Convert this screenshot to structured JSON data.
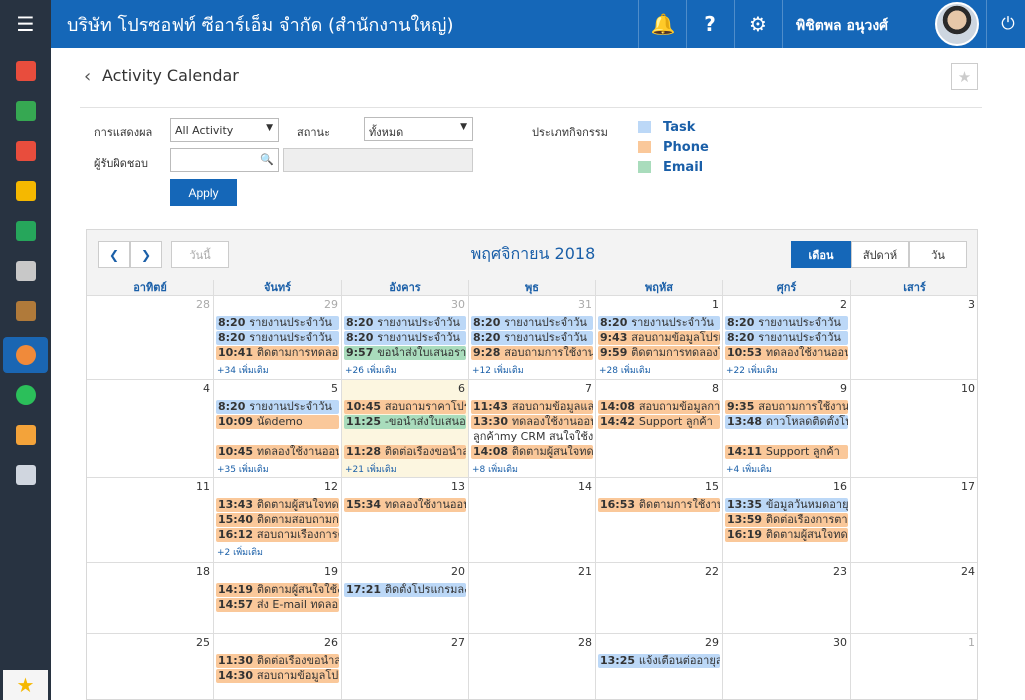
{
  "header": {
    "company": "บริษัท โปรซอฟท์ ซีอาร์เอ็ม จำกัด (สำนักงานใหญ่)",
    "username": "พิชิตพล อนุวงศ์"
  },
  "page": {
    "title": "Activity Calendar"
  },
  "filters": {
    "display_label": "การแสดงผล",
    "display_value": "All Activity",
    "status_label": "สถานะ",
    "status_value": "ทั้งหมด",
    "owner_label": "ผู้รับผิดชอบ",
    "owner_value": "",
    "apply_label": "Apply",
    "type_label": "ประเภทกิจกรรม"
  },
  "legend": [
    {
      "label": "Task",
      "color": "#bcd8f7"
    },
    {
      "label": "Phone",
      "color": "#fac89a"
    },
    {
      "label": "Email",
      "color": "#a9dcbc"
    }
  ],
  "calendar": {
    "today_label": "วันนี้",
    "month_title": "พฤศจิกายน 2018",
    "views": [
      "เดือน",
      "สัปดาห์",
      "วัน"
    ],
    "active_view": "เดือน",
    "weekdays": [
      "อาทิตย์",
      "จันทร์",
      "อังคาร",
      "พุธ",
      "พฤหัส",
      "ศุกร์",
      "เสาร์"
    ],
    "weeks": [
      [
        {
          "day": "28",
          "other": true,
          "events": []
        },
        {
          "day": "29",
          "other": true,
          "events": [
            {
              "type": "task",
              "time": "8:20",
              "text": "รายงานประจำวัน"
            },
            {
              "type": "task",
              "time": "8:20",
              "text": "รายงานประจำวัน"
            },
            {
              "type": "phone",
              "time": "10:41",
              "text": "ติดตามการทดลองใ"
            }
          ],
          "more": "+34 เพิ่มเติม"
        },
        {
          "day": "30",
          "other": true,
          "events": [
            {
              "type": "task",
              "time": "8:20",
              "text": "รายงานประจำวัน"
            },
            {
              "type": "task",
              "time": "8:20",
              "text": "รายงานประจำวัน"
            },
            {
              "type": "email",
              "time": "9:57",
              "text": "ขอนำส่งใบเสนอราค"
            }
          ],
          "more": "+26 เพิ่มเติม"
        },
        {
          "day": "31",
          "other": true,
          "events": [
            {
              "type": "task",
              "time": "8:20",
              "text": "รายงานประจำวัน"
            },
            {
              "type": "task",
              "time": "8:20",
              "text": "รายงานประจำวัน"
            },
            {
              "type": "phone",
              "time": "9:28",
              "text": "สอบถามการใช้งานโ"
            }
          ],
          "more": "+12 เพิ่มเติม"
        },
        {
          "day": "1",
          "other": false,
          "events": [
            {
              "type": "task",
              "time": "8:20",
              "text": "รายงานประจำวัน"
            },
            {
              "type": "phone",
              "time": "9:43",
              "text": "สอบถามข้อมูลโปรแ"
            },
            {
              "type": "phone",
              "time": "9:59",
              "text": "ติดตามการทดลองใ"
            }
          ],
          "more": "+28 เพิ่มเติม"
        },
        {
          "day": "2",
          "other": false,
          "events": [
            {
              "type": "task",
              "time": "8:20",
              "text": "รายงานประจำวัน"
            },
            {
              "type": "task",
              "time": "8:20",
              "text": "รายงานประจำวัน"
            },
            {
              "type": "phone",
              "time": "10:53",
              "text": "ทดลองใช้งานออนไ"
            }
          ],
          "more": "+22 เพิ่มเติม"
        },
        {
          "day": "3",
          "other": false,
          "events": []
        }
      ],
      [
        {
          "day": "4",
          "other": false,
          "events": []
        },
        {
          "day": "5",
          "other": false,
          "events": [
            {
              "type": "task",
              "time": "8:20",
              "text": "รายงานประจำวัน"
            },
            {
              "type": "phone",
              "time": "10:09",
              "text": "นัดdemo"
            },
            {
              "type": "plain",
              "time": "",
              "text": ""
            },
            {
              "type": "phone",
              "time": "10:45",
              "text": "ทดลองใช้งานออนไ"
            }
          ],
          "more": "+35 เพิ่มเติม"
        },
        {
          "day": "6",
          "other": false,
          "today": true,
          "events": [
            {
              "type": "phone",
              "time": "10:45",
              "text": "สอบถามราคาโปรแ"
            },
            {
              "type": "email",
              "time": "11:25",
              "text": "-ขอนำส่งใบเสนอรา"
            },
            {
              "type": "plain",
              "time": "",
              "text": ""
            },
            {
              "type": "phone",
              "time": "11:28",
              "text": "ติดต่อเรื่องขอนำส่ง"
            }
          ],
          "more": "+21 เพิ่มเติม"
        },
        {
          "day": "7",
          "other": false,
          "events": [
            {
              "type": "phone",
              "time": "11:43",
              "text": "สอบถามข้อมูลและ"
            },
            {
              "type": "phone",
              "time": "13:30",
              "text": "ทดลองใช้งานออนไ"
            },
            {
              "type": "plain",
              "time": "",
              "text": "ลูกค้าmy CRM สนใจใช้งาน"
            },
            {
              "type": "phone",
              "time": "14:08",
              "text": "ติดตามผู้สนใจทดล"
            }
          ],
          "more": "+8 เพิ่มเติม"
        },
        {
          "day": "8",
          "other": false,
          "events": [
            {
              "type": "phone",
              "time": "14:08",
              "text": "สอบถามข้อมูลการใ"
            },
            {
              "type": "phone",
              "time": "14:42",
              "text": "Support ลูกค้า"
            }
          ]
        },
        {
          "day": "9",
          "other": false,
          "events": [
            {
              "type": "phone",
              "time": "9:35",
              "text": "สอบถามการใช้งานโ"
            },
            {
              "type": "task",
              "time": "13:48",
              "text": "ดาวโหลดติดตั้งโปร"
            },
            {
              "type": "plain",
              "time": "",
              "text": ""
            },
            {
              "type": "phone",
              "time": "14:11",
              "text": "Support ลูกค้า"
            }
          ],
          "more": "+4 เพิ่มเติม"
        },
        {
          "day": "10",
          "other": false,
          "events": []
        }
      ],
      [
        {
          "day": "11",
          "other": false,
          "events": []
        },
        {
          "day": "12",
          "other": false,
          "events": [
            {
              "type": "phone",
              "time": "13:43",
              "text": "ติดตามผู้สนใจทดล"
            },
            {
              "type": "phone",
              "time": "15:40",
              "text": "ติดตามสอบถามการ"
            },
            {
              "type": "phone",
              "time": "16:12",
              "text": "สอบถามเรื่องการตั"
            }
          ],
          "more": "+2 เพิ่มเติม"
        },
        {
          "day": "13",
          "other": false,
          "events": [
            {
              "type": "phone",
              "time": "15:34",
              "text": "ทดลองใช้งานออนไ"
            }
          ]
        },
        {
          "day": "14",
          "other": false,
          "events": []
        },
        {
          "day": "15",
          "other": false,
          "events": [
            {
              "type": "phone",
              "time": "16:53",
              "text": "ติดตามการใช้งาน"
            }
          ]
        },
        {
          "day": "16",
          "other": false,
          "events": [
            {
              "type": "task",
              "time": "13:35",
              "text": "ข้อมูลวันหมดอายุล"
            },
            {
              "type": "phone",
              "time": "13:59",
              "text": "ติดต่อเรื่องการตาม"
            },
            {
              "type": "phone",
              "time": "16:19",
              "text": "ติดตามผู้สนใจทดล"
            }
          ]
        },
        {
          "day": "17",
          "other": false,
          "events": []
        }
      ],
      [
        {
          "day": "18",
          "other": false,
          "events": []
        },
        {
          "day": "19",
          "other": false,
          "events": [
            {
              "type": "phone",
              "time": "14:19",
              "text": "ติดตามผู้สนใจใช้งา"
            },
            {
              "type": "phone",
              "time": "14:57",
              "text": "ส่ง E-mail ทดลองใ"
            }
          ]
        },
        {
          "day": "20",
          "other": false,
          "events": [
            {
              "type": "task",
              "time": "17:21",
              "text": "ติดตั้งโปรแกรมลงใ"
            }
          ]
        },
        {
          "day": "21",
          "other": false,
          "events": []
        },
        {
          "day": "22",
          "other": false,
          "events": []
        },
        {
          "day": "23",
          "other": false,
          "events": []
        },
        {
          "day": "24",
          "other": false,
          "events": []
        }
      ],
      [
        {
          "day": "25",
          "other": false,
          "events": []
        },
        {
          "day": "26",
          "other": false,
          "events": [
            {
              "type": "phone",
              "time": "11:30",
              "text": "ติดต่อเรื่องขอนำส่ง"
            },
            {
              "type": "phone",
              "time": "14:30",
              "text": "สอบถามข้อมูลโปรแ"
            }
          ]
        },
        {
          "day": "27",
          "other": false,
          "events": []
        },
        {
          "day": "28",
          "other": false,
          "events": []
        },
        {
          "day": "29",
          "other": false,
          "events": [
            {
              "type": "task",
              "time": "13:25",
              "text": "แจ้งเตือนต่ออายุลา"
            }
          ]
        },
        {
          "day": "30",
          "other": false,
          "events": []
        },
        {
          "day": "1",
          "other": true,
          "events": []
        }
      ]
    ]
  }
}
